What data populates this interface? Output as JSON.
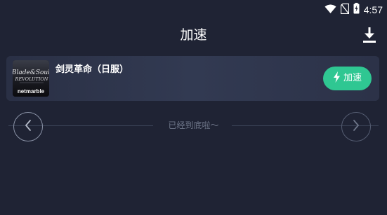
{
  "status_bar": {
    "time": "4:57",
    "icons": [
      "wifi-icon",
      "no-sim-icon",
      "battery-charging-icon"
    ]
  },
  "header": {
    "title": "加速",
    "action_icon": "download-icon"
  },
  "game": {
    "name": "剑灵革命（日服）",
    "icon": "blade-and-soul-revolution-app-icon",
    "icon_brand": "netmarble",
    "icon_title_line1": "Blade&Soul",
    "icon_title_line2": "REVOLUTION",
    "accelerate_label": "加速",
    "accelerate_icon": "lightning-icon"
  },
  "list_end": {
    "text": "已经到底啦～",
    "prev_icon": "chevron-left-icon",
    "next_icon": "chevron-right-icon"
  },
  "colors": {
    "background": "#1f2334",
    "card": "#2e3549",
    "accent": "#2fc792",
    "muted_text": "#6e7689"
  }
}
